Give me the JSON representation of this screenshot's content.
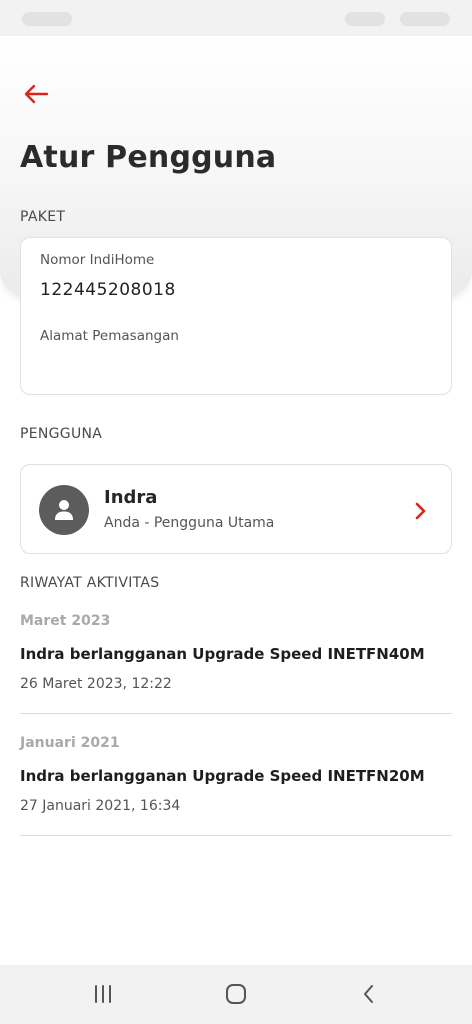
{
  "header": {
    "title": "Atur Pengguna",
    "back_icon": "arrow-left-icon",
    "accent_color": "#d9261c"
  },
  "paket": {
    "section_label": "PAKET",
    "nomor_label": "Nomor IndiHome",
    "nomor_value": "122445208018",
    "alamat_label": "Alamat Pemasangan",
    "alamat_value": ""
  },
  "pengguna": {
    "section_label": "PENGGUNA",
    "name": "Indra",
    "role": "Anda - Pengguna Utama",
    "avatar_icon": "user-icon",
    "chevron_icon": "chevron-right-icon"
  },
  "riwayat": {
    "section_label": "RIWAYAT AKTIVITAS",
    "groups": [
      {
        "month": "Maret 2023",
        "title": "Indra berlangganan Upgrade Speed INETFN40M",
        "date": "26 Maret 2023, 12:22"
      },
      {
        "month": "Januari 2021",
        "title": "Indra berlangganan Upgrade Speed INETFN20M",
        "date": "27 Januari 2021, 16:34"
      }
    ]
  },
  "nav": {
    "recent_icon": "recent-apps-icon",
    "home_icon": "home-icon",
    "back_icon": "back-icon"
  }
}
